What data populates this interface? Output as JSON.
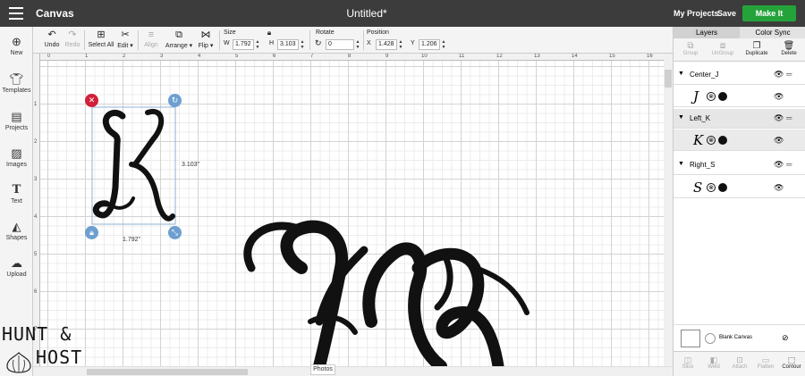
{
  "header": {
    "app_title": "Canvas",
    "doc_title": "Untitled*",
    "my_projects": "My Projects",
    "save": "Save",
    "make_it": "Make It"
  },
  "toolbar": {
    "undo": "Undo",
    "redo": "Redo",
    "select_all": "Select All",
    "edit": "Edit ▾",
    "align": "Align",
    "arrange": "Arrange ▾",
    "flip": "Flip ▾",
    "size_label": "Size",
    "w_letter": "W",
    "w_value": "1.792",
    "h_letter": "H",
    "h_value": "3.103",
    "rotate_label": "Rotate",
    "rotate_value": "0",
    "position_label": "Position",
    "x_letter": "X",
    "x_value": "1.428",
    "y_letter": "Y",
    "y_value": "1.206"
  },
  "leftnav": {
    "items": [
      "New",
      "Templates",
      "Projects",
      "Images",
      "Text",
      "Shapes",
      "Upload"
    ]
  },
  "canvas": {
    "ruler_x": [
      "0",
      "1",
      "2",
      "3",
      "4",
      "5",
      "6",
      "7",
      "8",
      "9",
      "10",
      "11",
      "12",
      "13",
      "14",
      "15",
      "16"
    ],
    "ruler_y": [
      "1",
      "2",
      "3",
      "4",
      "5",
      "6",
      "7"
    ],
    "selected_glyph": "K",
    "height_dim": "3.103\"",
    "width_dim": "1.792\"",
    "photos_tab": "Photos"
  },
  "panel": {
    "tab_layers": "Layers",
    "tab_color_sync": "Color Sync",
    "actions": [
      "Group",
      "UnGroup",
      "Duplicate",
      "Delete"
    ],
    "groups": [
      {
        "name": "Center_J",
        "glyph": "J"
      },
      {
        "name": "Left_K",
        "glyph": "K"
      },
      {
        "name": "Right_S",
        "glyph": "S"
      }
    ],
    "blank_canvas": "Blank Canvas",
    "bottom_actions": [
      "Slice",
      "Weld",
      "Attach",
      "Flatten",
      "Contour"
    ]
  },
  "watermark": {
    "line1": "HUNT &",
    "line2": "HOST"
  }
}
